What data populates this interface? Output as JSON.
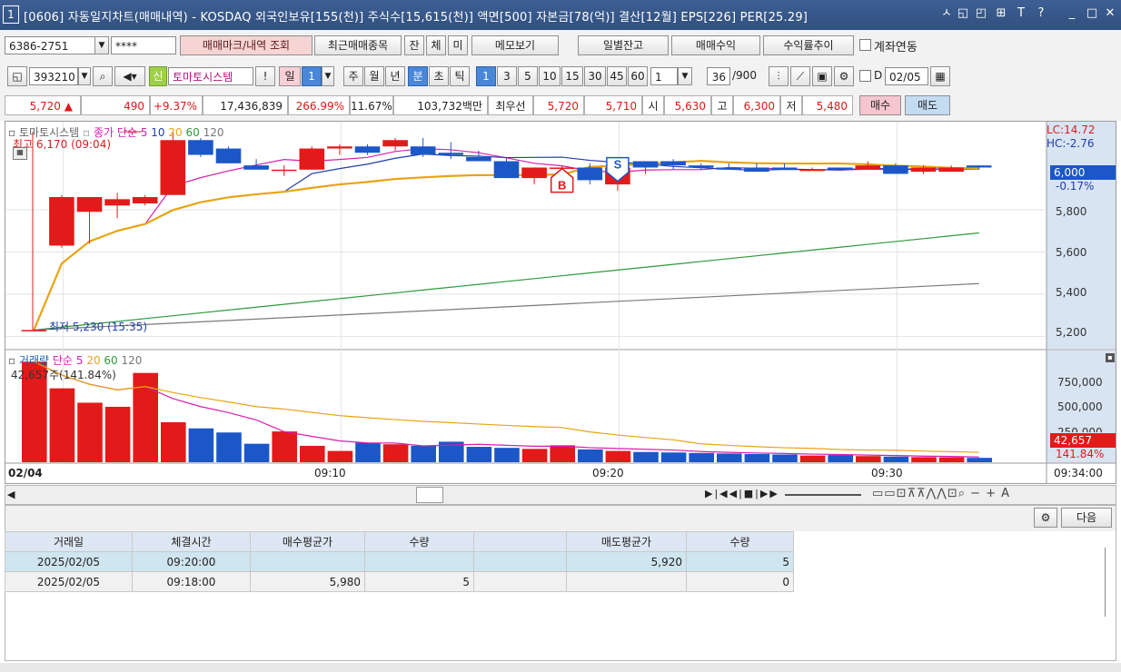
{
  "window": {
    "num": "1",
    "title": "[0606] 자동일지차트(매매내역) - KOSDAQ 외국인보유[155(천)] 주식수[15,615(천)] 액면[500] 자본금[78(억)] 결산[12월] EPS[226] PER[25.29]",
    "icons": [
      "ㅅ",
      "◱",
      "◰",
      "⊞",
      "T",
      "?",
      "_",
      "□",
      "✕"
    ]
  },
  "row1": {
    "account": "6386-2751",
    "password": "****",
    "btn_trade_mark": "매매마크/내역 조회",
    "btn_recent": "최근매매종목",
    "btn_jan": "잔",
    "btn_che": "체",
    "btn_mi": "미",
    "btn_memo": "메모보기",
    "btn_daily_balance": "일별잔고",
    "btn_profit": "매매수익",
    "btn_yield": "수익률추이",
    "chk_account_link": "계좌연동"
  },
  "row2": {
    "code": "393210",
    "badge_sin": "신",
    "stock_name": "토마토시스템",
    "btn_excl": "!",
    "tabs_period": [
      "일",
      "1",
      "주",
      "월",
      "년",
      "분",
      "초",
      "틱"
    ],
    "minute_options": [
      "1",
      "3",
      "5",
      "10",
      "15",
      "30",
      "45",
      "60"
    ],
    "count_value": "1",
    "range_value": "36",
    "range_total": "/900",
    "date_chk": "D",
    "date_value": "02/05"
  },
  "row3": {
    "price": "5,720",
    "up_arrow": "▲",
    "change": "490",
    "change_pct": "+9.37%",
    "volume": "17,436,839",
    "vol_ratio": "266.99%",
    "turnover": "11.67%",
    "amount": "103,732백만",
    "best_ask_label": "최우선",
    "best_ask": "5,720",
    "best_bid": "5,710",
    "open_label": "시",
    "open": "5,630",
    "high_label": "고",
    "high": "6,300",
    "low_label": "저",
    "low": "5,480",
    "buy_btn": "매수",
    "sell_btn": "매도"
  },
  "price_legend": {
    "name": "토마토시스템",
    "ma_label": "종가 단순",
    "periods": [
      "5",
      "10",
      "20",
      "60",
      "120"
    ],
    "high_note": "최고 6,170 (09:04)",
    "low_note": "최저 5,230 (15:35)",
    "lc": "LC:14.72",
    "hc": "HC:-2.76",
    "current_label": "6,000",
    "current_pct": "-0.17%",
    "marker_buy": "B",
    "marker_sell": "S"
  },
  "volume_legend": {
    "label": "거래량",
    "ma_label": "단순",
    "periods": [
      "5",
      "20",
      "60",
      "120"
    ],
    "note": "42,657주(141.84%)",
    "current": "42,657",
    "current_pct": "141.84%"
  },
  "y_axis_price": [
    "5,800",
    "5,600",
    "5,400",
    "5,200"
  ],
  "y_axis_volume": [
    "750,000",
    "500,000",
    "250,000"
  ],
  "x_axis": {
    "start": "02/04",
    "ticks": [
      "09:10",
      "09:20",
      "09:30"
    ],
    "end": "09:34:00"
  },
  "colors": {
    "up": "#e31a1a",
    "down": "#1c57c8",
    "ma5": "#d61fb0",
    "ma10": "#1f3ea8",
    "ma20": "#e8a413",
    "ma60": "#2e9a3b",
    "ma120": "#7a7a7a",
    "axis_bg": "#d9e4f3"
  },
  "chart_data": {
    "type": "candlestick",
    "candles": [
      {
        "o": 5230,
        "h": 5230,
        "l": 5230,
        "c": 5230
      },
      {
        "o": 5630,
        "h": 5870,
        "l": 5620,
        "c": 5860
      },
      {
        "o": 5790,
        "h": 5860,
        "l": 5640,
        "c": 5860
      },
      {
        "o": 5820,
        "h": 5880,
        "l": 5760,
        "c": 5850
      },
      {
        "o": 5830,
        "h": 5870,
        "l": 5820,
        "c": 5860
      },
      {
        "o": 5870,
        "h": 6170,
        "l": 5870,
        "c": 6130
      },
      {
        "o": 6130,
        "h": 6140,
        "l": 6050,
        "c": 6060
      },
      {
        "o": 6090,
        "h": 6100,
        "l": 6020,
        "c": 6020
      },
      {
        "o": 6010,
        "h": 6040,
        "l": 5990,
        "c": 5990
      },
      {
        "o": 5990,
        "h": 6010,
        "l": 5960,
        "c": 5990
      },
      {
        "o": 5990,
        "h": 6100,
        "l": 5990,
        "c": 6090
      },
      {
        "o": 6090,
        "h": 6110,
        "l": 6060,
        "c": 6100
      },
      {
        "o": 6100,
        "h": 6110,
        "l": 6060,
        "c": 6070
      },
      {
        "o": 6100,
        "h": 6140,
        "l": 6080,
        "c": 6130
      },
      {
        "o": 6100,
        "h": 6140,
        "l": 6050,
        "c": 6060
      },
      {
        "o": 6070,
        "h": 6120,
        "l": 6040,
        "c": 6060
      },
      {
        "o": 6050,
        "h": 6080,
        "l": 6030,
        "c": 6030
      },
      {
        "o": 6030,
        "h": 6050,
        "l": 5950,
        "c": 5950
      },
      {
        "o": 5950,
        "h": 6000,
        "l": 5920,
        "c": 6000
      },
      {
        "o": 6000,
        "h": 6010,
        "l": 5980,
        "c": 6000
      },
      {
        "o": 6000,
        "h": 6020,
        "l": 5920,
        "c": 5940
      },
      {
        "o": 5920,
        "h": 6000,
        "l": 5890,
        "c": 6000
      },
      {
        "o": 6030,
        "h": 6030,
        "l": 5970,
        "c": 6000
      },
      {
        "o": 6030,
        "h": 6040,
        "l": 5990,
        "c": 6010
      },
      {
        "o": 6010,
        "h": 6020,
        "l": 5990,
        "c": 6000
      },
      {
        "o": 6000,
        "h": 6020,
        "l": 5990,
        "c": 5990
      },
      {
        "o": 6000,
        "h": 6020,
        "l": 5980,
        "c": 5980
      },
      {
        "o": 6000,
        "h": 6020,
        "l": 5990,
        "c": 5990
      },
      {
        "o": 5990,
        "h": 6000,
        "l": 5990,
        "c": 5990
      },
      {
        "o": 6000,
        "h": 6000,
        "l": 5990,
        "c": 5990
      },
      {
        "o": 5990,
        "h": 6030,
        "l": 5990,
        "c": 6010
      },
      {
        "o": 6010,
        "h": 6020,
        "l": 5970,
        "c": 5970
      },
      {
        "o": 5980,
        "h": 6010,
        "l": 5970,
        "c": 6000
      },
      {
        "o": 5980,
        "h": 6010,
        "l": 5980,
        "c": 6000
      },
      {
        "o": 6010,
        "h": 6010,
        "l": 5990,
        "c": 6000
      }
    ],
    "volumes": [
      980000,
      720000,
      580000,
      540000,
      870000,
      390000,
      330000,
      290000,
      180000,
      300000,
      160000,
      110000,
      190000,
      175000,
      160000,
      200000,
      150000,
      140000,
      130000,
      165000,
      125000,
      110000,
      100000,
      95000,
      90000,
      85000,
      80000,
      75000,
      65000,
      70000,
      60000,
      55000,
      50000,
      48000,
      42657
    ],
    "ma20_last": 6000,
    "ma60_last": 5690,
    "ma120_last": 5450,
    "ylim": [
      5150,
      6200
    ],
    "vol_ylim": [
      0,
      1000000
    ]
  },
  "footer_toolbar": {
    "btn_next": "다음"
  },
  "trade_table": {
    "headers": [
      "거래일",
      "체결시간",
      "매수평균가",
      "수량",
      "",
      "매도평균가",
      "수량"
    ],
    "rows": [
      [
        "2025/02/05",
        "09:20:00",
        "",
        "",
        "",
        "5,920",
        "5"
      ],
      [
        "2025/02/05",
        "09:18:00",
        "5,980",
        "5",
        "",
        "",
        "0"
      ]
    ]
  }
}
